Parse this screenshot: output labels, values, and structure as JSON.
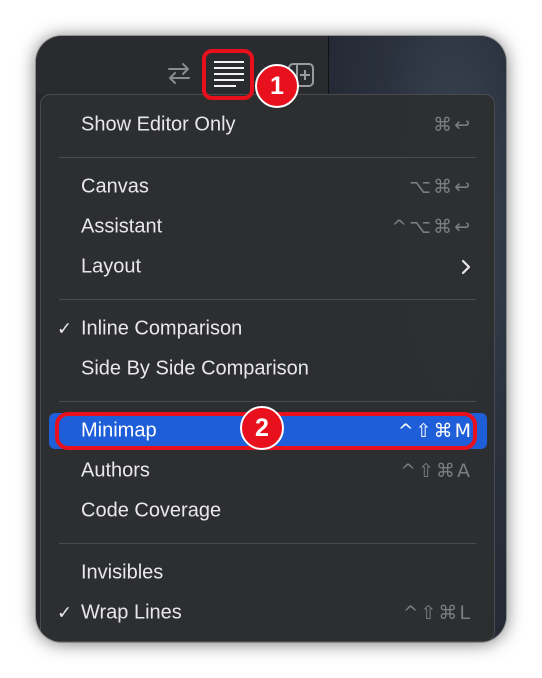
{
  "toolbar": {
    "icons": [
      "swap-arrows-icon",
      "editor-options-icon",
      "add-editor-icon"
    ]
  },
  "callouts": {
    "badge_1": "1",
    "badge_2": "2"
  },
  "menu": {
    "items": [
      {
        "label": "Show Editor Only",
        "shortcut": "⌘↩",
        "checked": false,
        "submenu": false
      },
      {
        "label": "Canvas",
        "shortcut": "⌥⌘↩",
        "checked": false,
        "submenu": false
      },
      {
        "label": "Assistant",
        "shortcut": "^⌥⌘↩",
        "checked": false,
        "submenu": false
      },
      {
        "label": "Layout",
        "shortcut": "",
        "checked": false,
        "submenu": true
      },
      {
        "label": "Inline Comparison",
        "shortcut": "",
        "checked": true,
        "submenu": false
      },
      {
        "label": "Side By Side Comparison",
        "shortcut": "",
        "checked": false,
        "submenu": false
      },
      {
        "label": "Minimap",
        "shortcut": "^⇧⌘M",
        "checked": false,
        "submenu": false,
        "selected": true
      },
      {
        "label": "Authors",
        "shortcut": "^⇧⌘A",
        "checked": false,
        "submenu": false
      },
      {
        "label": "Code Coverage",
        "shortcut": "",
        "checked": false,
        "submenu": false
      },
      {
        "label": "Invisibles",
        "shortcut": "",
        "checked": false,
        "submenu": false
      },
      {
        "label": "Wrap Lines",
        "shortcut": "^⇧⌘L",
        "checked": true,
        "submenu": false
      }
    ],
    "check_glyph": "✓"
  },
  "colors": {
    "selection": "#1e5ed8",
    "callout": "#e8101c"
  }
}
